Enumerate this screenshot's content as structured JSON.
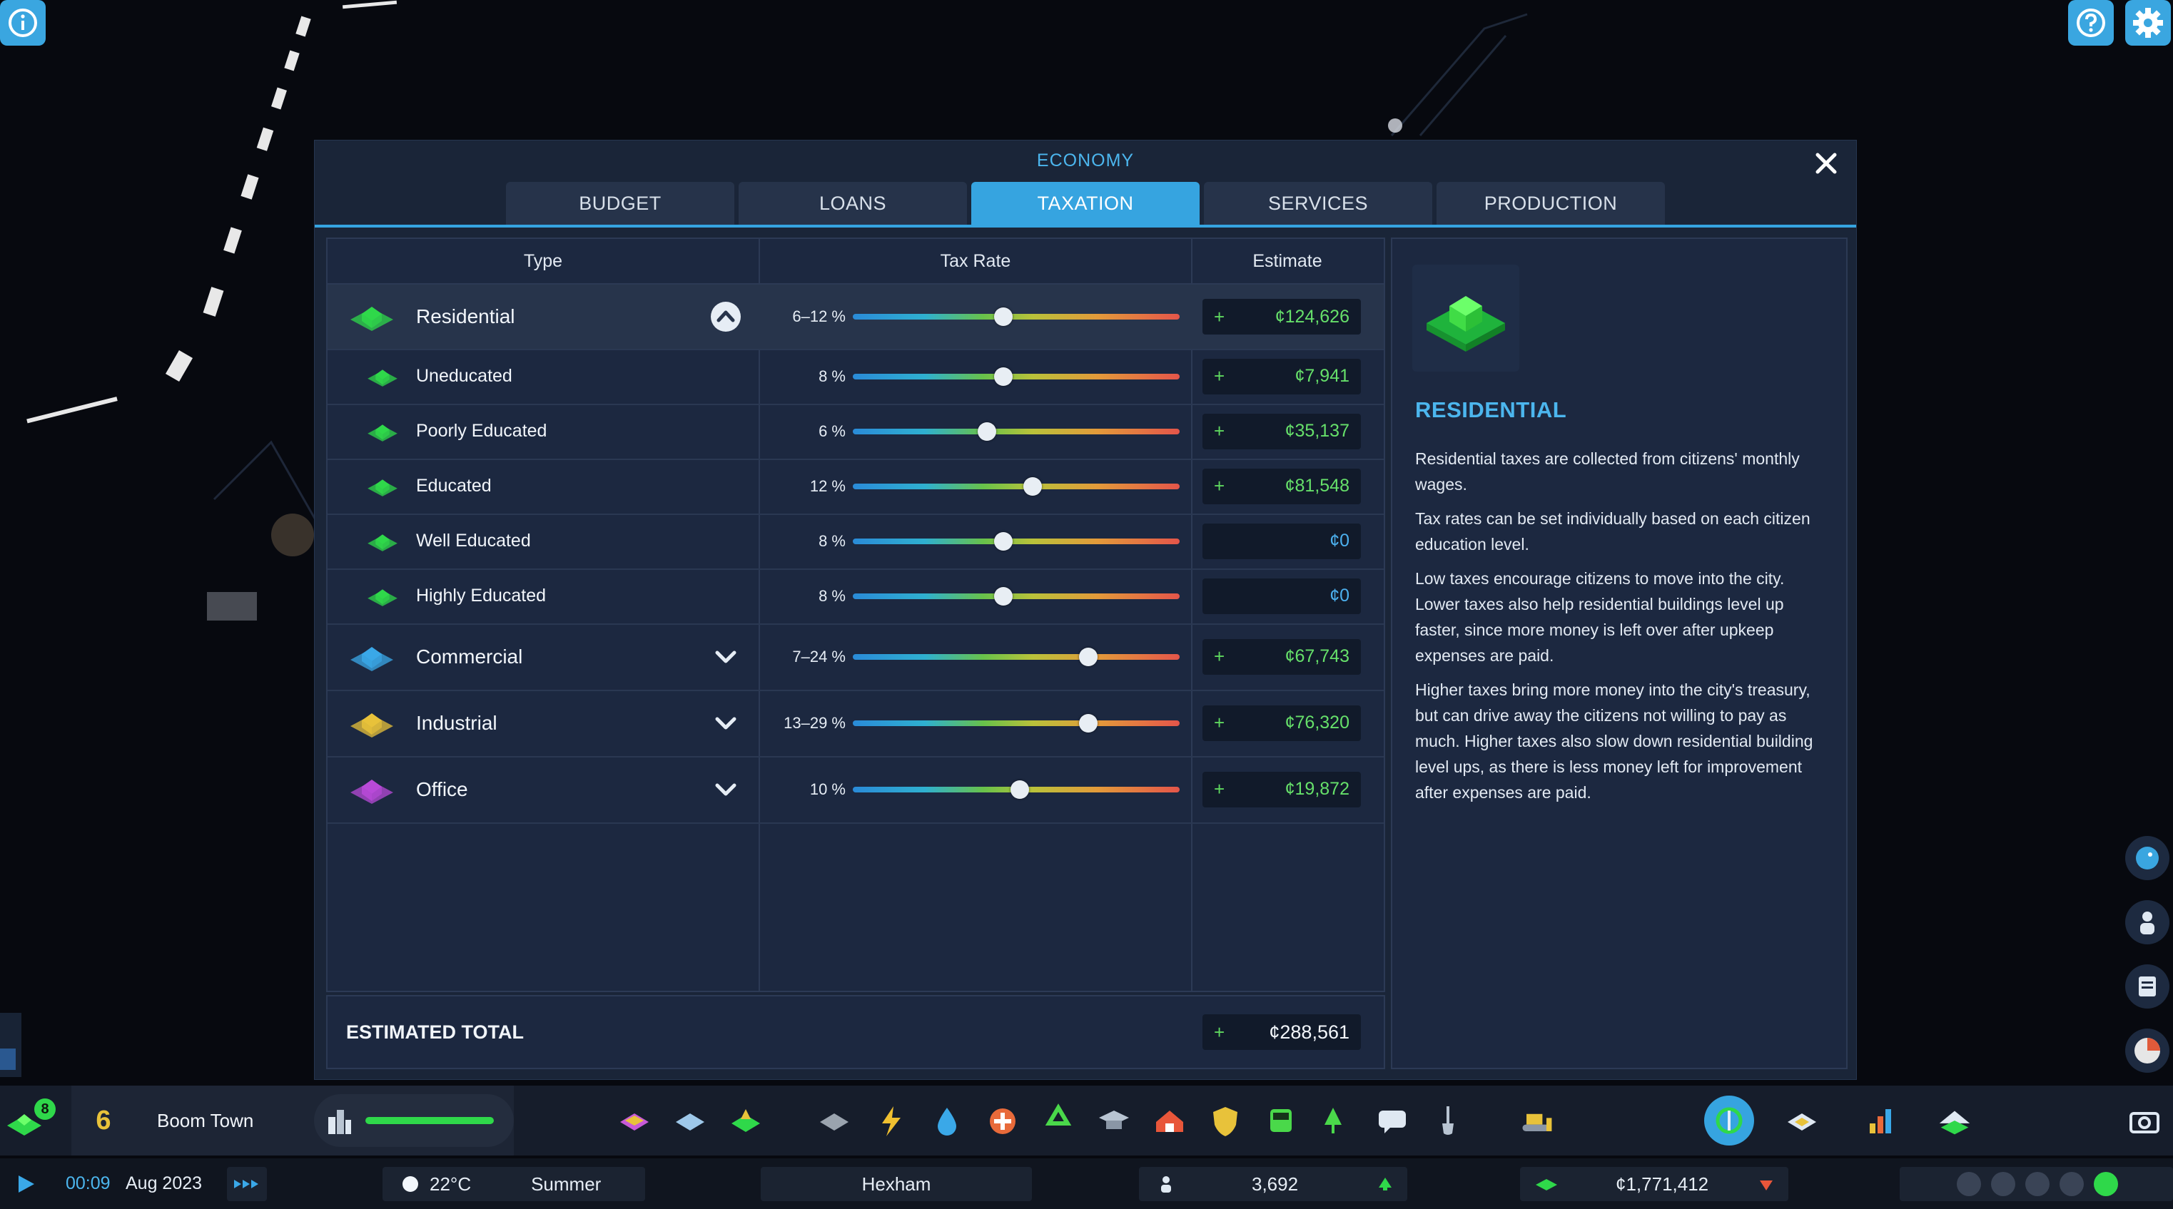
{
  "panel": {
    "title": "ECONOMY",
    "tabs": [
      {
        "label": "BUDGET",
        "active": false
      },
      {
        "label": "LOANS",
        "active": false
      },
      {
        "label": "TAXATION",
        "active": true
      },
      {
        "label": "SERVICES",
        "active": false
      },
      {
        "label": "PRODUCTION",
        "active": false
      }
    ]
  },
  "table": {
    "headers": {
      "type": "Type",
      "rate": "Tax Rate",
      "estimate": "Estimate"
    },
    "rows": [
      {
        "label": "Residential",
        "rate": "6–12 %",
        "slider": 0.46,
        "estimate": "¢124,626",
        "plus": "+",
        "expanded": true
      },
      {
        "label": "Uneducated",
        "rate": "8 %",
        "slider": 0.46,
        "estimate": "¢7,941",
        "plus": "+"
      },
      {
        "label": "Poorly Educated",
        "rate": "6 %",
        "slider": 0.41,
        "estimate": "¢35,137",
        "plus": "+"
      },
      {
        "label": "Educated",
        "rate": "12 %",
        "slider": 0.55,
        "estimate": "¢81,548",
        "plus": "+"
      },
      {
        "label": "Well Educated",
        "rate": "8 %",
        "slider": 0.46,
        "estimate": "¢0",
        "plus": ""
      },
      {
        "label": "Highly Educated",
        "rate": "8 %",
        "slider": 0.46,
        "estimate": "¢0",
        "plus": ""
      },
      {
        "label": "Commercial",
        "rate": "7–24 %",
        "slider": 0.72,
        "estimate": "¢67,743",
        "plus": "+"
      },
      {
        "label": "Industrial",
        "rate": "13–29 %",
        "slider": 0.72,
        "estimate": "¢76,320",
        "plus": "+"
      },
      {
        "label": "Office",
        "rate": "10 %",
        "slider": 0.51,
        "estimate": "¢19,872",
        "plus": "+"
      }
    ],
    "total": {
      "label": "ESTIMATED TOTAL",
      "plus": "+",
      "value": "¢288,561"
    }
  },
  "info": {
    "title": "RESIDENTIAL",
    "paragraphs": [
      "Residential taxes are collected from citizens' monthly wages.",
      "Tax rates can be set individually based on each citizen education level.",
      "Low taxes encourage citizens to move into the city. Lower taxes also help residential buildings level up faster, since more money is left over after upkeep expenses are paid.",
      "Higher taxes bring more money into the city's treasury, but can drive away the citizens not willing to pay as much. Higher taxes also slow down residential building level ups, as there is less money left for improvement after expenses are paid."
    ]
  },
  "toolbar": {
    "badge": "8",
    "milestone": "6",
    "city_name": "Boom Town",
    "progress": 1.0
  },
  "status": {
    "time": "00:09",
    "date": "Aug 2023",
    "temperature": "22°C",
    "season": "Summer",
    "location": "Hexham",
    "population": "3,692",
    "money": "¢1,771,412"
  },
  "colors": {
    "accent": "#36a4e0",
    "positive": "#66e06a",
    "residential": "#2fd84a",
    "commercial": "#3aa8e8",
    "industrial": "#e8c23a",
    "office": "#b84ad8"
  }
}
